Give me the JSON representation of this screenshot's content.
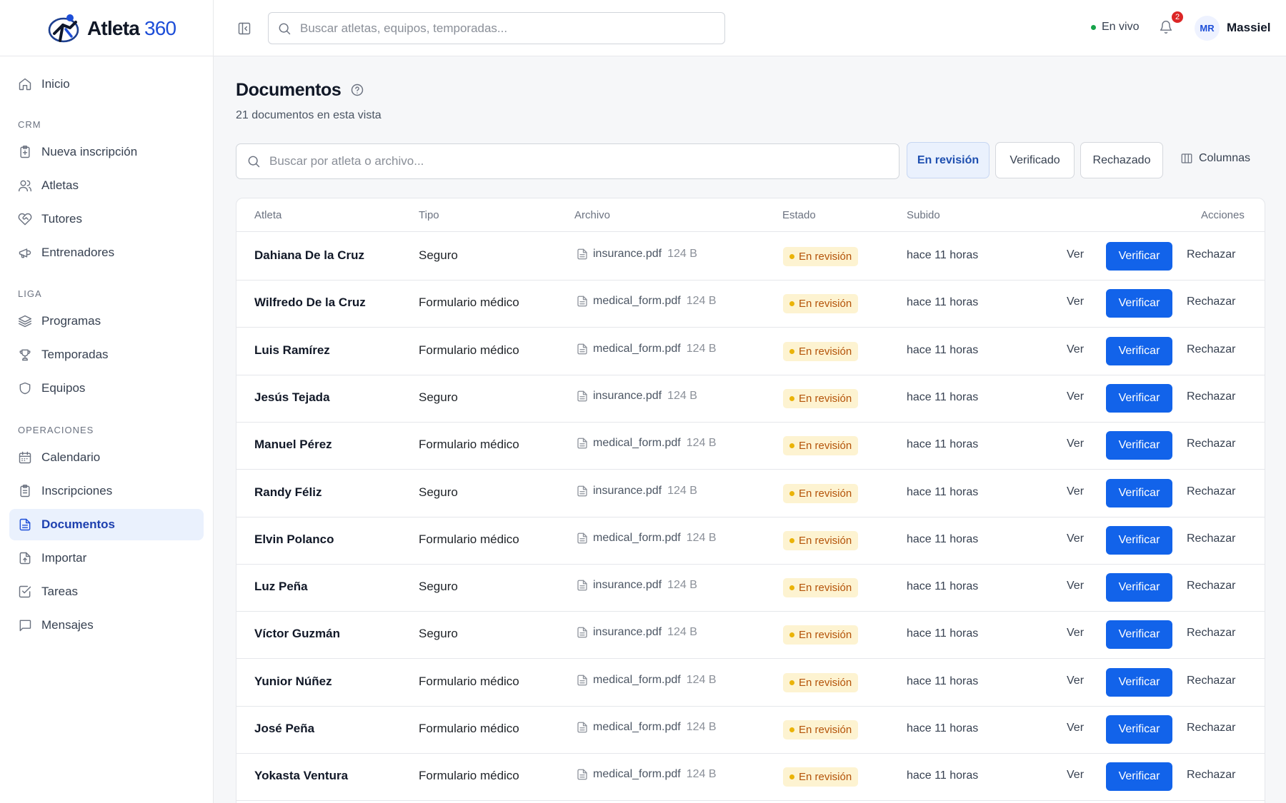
{
  "brand": {
    "name": "Atleta",
    "number": "360"
  },
  "header": {
    "search_placeholder": "Buscar atletas, equipos, temporadas...",
    "live_label": "En vivo",
    "notifications_count": "2",
    "user_initials": "MR",
    "user_name": "Massiel"
  },
  "sidebar": {
    "home": "Inicio",
    "sections": [
      "CRM",
      "LIGA",
      "OPERACIONES"
    ],
    "crm": [
      "Nueva inscripción",
      "Atletas",
      "Tutores",
      "Entrenadores"
    ],
    "liga": [
      "Programas",
      "Temporadas",
      "Equipos"
    ],
    "operaciones": [
      "Calendario",
      "Inscripciones",
      "Documentos",
      "Importar",
      "Tareas",
      "Mensajes"
    ],
    "active": "Documentos"
  },
  "page": {
    "title": "Documentos",
    "subtitle": "21 documentos en esta vista",
    "search_placeholder": "Buscar por atleta o archivo...",
    "filters": [
      "En revisión",
      "Verificado",
      "Rechazado"
    ],
    "active_filter": "En revisión",
    "columns_label": "Columnas"
  },
  "table": {
    "headers": [
      "Atleta",
      "Tipo",
      "Archivo",
      "Estado",
      "Subido",
      "Acciones"
    ],
    "actions": {
      "view": "Ver",
      "verify": "Verificar",
      "reject": "Rechazar"
    },
    "rows": [
      {
        "athlete": "Dahiana De la Cruz",
        "type": "Seguro",
        "file": "insurance.pdf",
        "size": "124 B",
        "status": "En revisión",
        "uploaded": "hace 11 horas"
      },
      {
        "athlete": "Wilfredo De la Cruz",
        "type": "Formulario médico",
        "file": "medical_form.pdf",
        "size": "124 B",
        "status": "En revisión",
        "uploaded": "hace 11 horas"
      },
      {
        "athlete": "Luis Ramírez",
        "type": "Formulario médico",
        "file": "medical_form.pdf",
        "size": "124 B",
        "status": "En revisión",
        "uploaded": "hace 11 horas"
      },
      {
        "athlete": "Jesús Tejada",
        "type": "Seguro",
        "file": "insurance.pdf",
        "size": "124 B",
        "status": "En revisión",
        "uploaded": "hace 11 horas"
      },
      {
        "athlete": "Manuel Pérez",
        "type": "Formulario médico",
        "file": "medical_form.pdf",
        "size": "124 B",
        "status": "En revisión",
        "uploaded": "hace 11 horas"
      },
      {
        "athlete": "Randy Féliz",
        "type": "Seguro",
        "file": "insurance.pdf",
        "size": "124 B",
        "status": "En revisión",
        "uploaded": "hace 11 horas"
      },
      {
        "athlete": "Elvin Polanco",
        "type": "Formulario médico",
        "file": "medical_form.pdf",
        "size": "124 B",
        "status": "En revisión",
        "uploaded": "hace 11 horas"
      },
      {
        "athlete": "Luz Peña",
        "type": "Seguro",
        "file": "insurance.pdf",
        "size": "124 B",
        "status": "En revisión",
        "uploaded": "hace 11 horas"
      },
      {
        "athlete": "Víctor Guzmán",
        "type": "Seguro",
        "file": "insurance.pdf",
        "size": "124 B",
        "status": "En revisión",
        "uploaded": "hace 11 horas"
      },
      {
        "athlete": "Yunior Núñez",
        "type": "Formulario médico",
        "file": "medical_form.pdf",
        "size": "124 B",
        "status": "En revisión",
        "uploaded": "hace 11 horas"
      },
      {
        "athlete": "José Peña",
        "type": "Formulario médico",
        "file": "medical_form.pdf",
        "size": "124 B",
        "status": "En revisión",
        "uploaded": "hace 11 horas"
      },
      {
        "athlete": "Yokasta Ventura",
        "type": "Formulario médico",
        "file": "medical_form.pdf",
        "size": "124 B",
        "status": "En revisión",
        "uploaded": "hace 11 horas"
      }
    ]
  },
  "colors": {
    "accent": "#1263ea",
    "status_review_bg": "#fdf3d1",
    "status_review_text": "#b45309",
    "live_dot": "#16a34a",
    "badge": "#dc2626"
  },
  "icons": {
    "brand": "runner-logo-icon",
    "collapse": "sidebar-collapse-icon",
    "search": "search-icon",
    "bell": "bell-icon",
    "help": "help-circle-icon",
    "columns": "columns-icon",
    "file": "file-icon"
  }
}
